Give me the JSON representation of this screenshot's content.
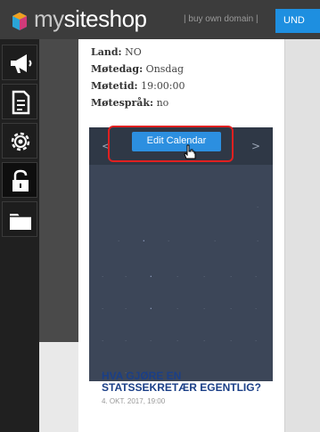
{
  "topbar": {
    "logo_my": "my",
    "logo_site": "siteshop",
    "buy_domain": "| buy own domain |",
    "undo_label": "UND"
  },
  "sidebar": {
    "tools": [
      {
        "icon": "megaphone-icon"
      },
      {
        "icon": "document-icon"
      },
      {
        "icon": "gear-icon"
      },
      {
        "icon": "unlock-icon"
      },
      {
        "icon": "folder-icon"
      }
    ]
  },
  "info": {
    "land_label": "Land:",
    "land_value": "NO",
    "motedag_label": "Møtedag:",
    "motedag_value": "Onsdag",
    "motetid_label": "Møtetid:",
    "motetid_value": "19:00:00",
    "motesprak_label": "Møtespråk:",
    "motesprak_value": "no"
  },
  "calendar": {
    "prev": "<",
    "next": ">",
    "edit_label": "Edit Calendar"
  },
  "article": {
    "title": "HVA GJØRE EN STATSSEKRETÆR EGENTLIG?",
    "date": "4. OKT. 2017, 19:00"
  },
  "colors": {
    "accent": "#1e8fe0",
    "topbar": "#3c3c3c",
    "sidebar": "#202020",
    "calendar": "#3c4658",
    "article_title": "#1b3f87",
    "highlight_outline": "#e02020"
  }
}
